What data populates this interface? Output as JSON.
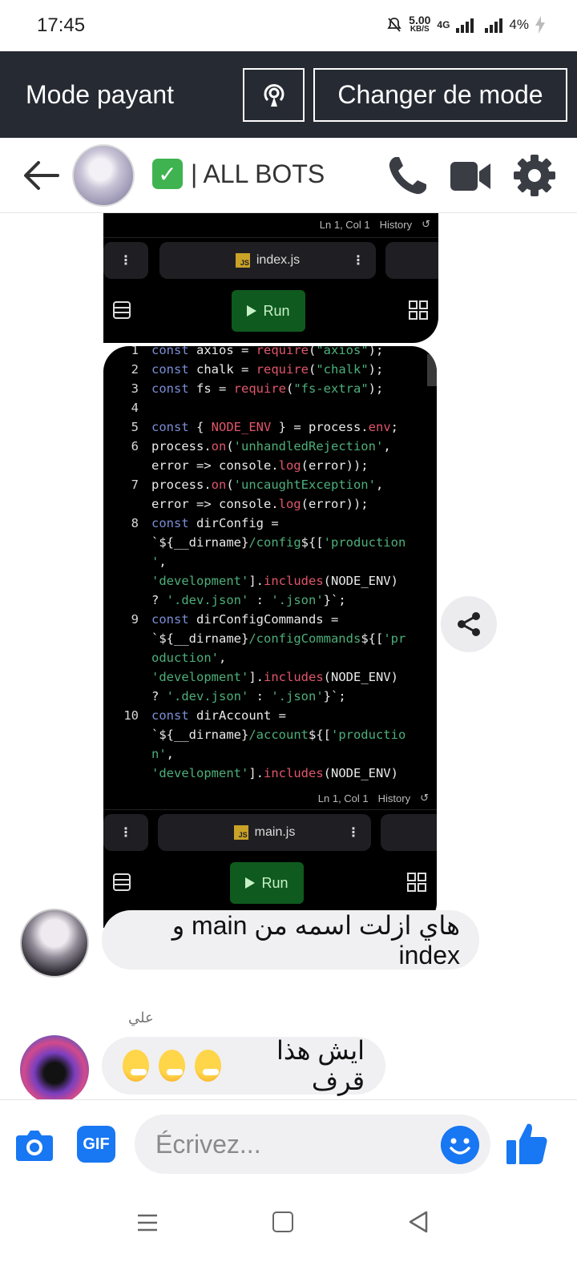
{
  "status_bar": {
    "time": "17:45",
    "net_speed": "5.00",
    "net_unit": "KB/S",
    "network": "4G",
    "battery": "4%"
  },
  "mode_bar": {
    "title": "Mode payant",
    "change_label": "Changer de mode"
  },
  "header": {
    "title": "| ALL BOTS",
    "check_emoji": "✓"
  },
  "code_card_1": {
    "status": "Ln 1, Col 1",
    "history": "History",
    "file": "index.js",
    "run": "Run",
    "badge": "JS"
  },
  "code_card_2": {
    "status": "Ln 1, Col 1",
    "history": "History",
    "file": "main.js",
    "run": "Run",
    "badge": "JS",
    "line_numbers": [
      "1",
      "2",
      "3",
      "4",
      "5",
      "6",
      "7",
      "8",
      "9",
      "10"
    ]
  },
  "messages": [
    {
      "text": "هاي ازلت اسمه من main و index"
    },
    {
      "sender": "علي",
      "text": "ايش هذا قرف"
    }
  ],
  "composer": {
    "placeholder": "Écrivez...",
    "gif": "GIF"
  },
  "colors": {
    "brand": "#1877f2",
    "mode_bar": "#262a33",
    "run": "#0f5a1e"
  },
  "icons": [
    "back-arrow-icon",
    "phone-icon",
    "video-camera-icon",
    "gear-icon",
    "share-icon",
    "camera-icon",
    "emoji-icon",
    "thumbs-up-icon",
    "broadcast-icon"
  ]
}
